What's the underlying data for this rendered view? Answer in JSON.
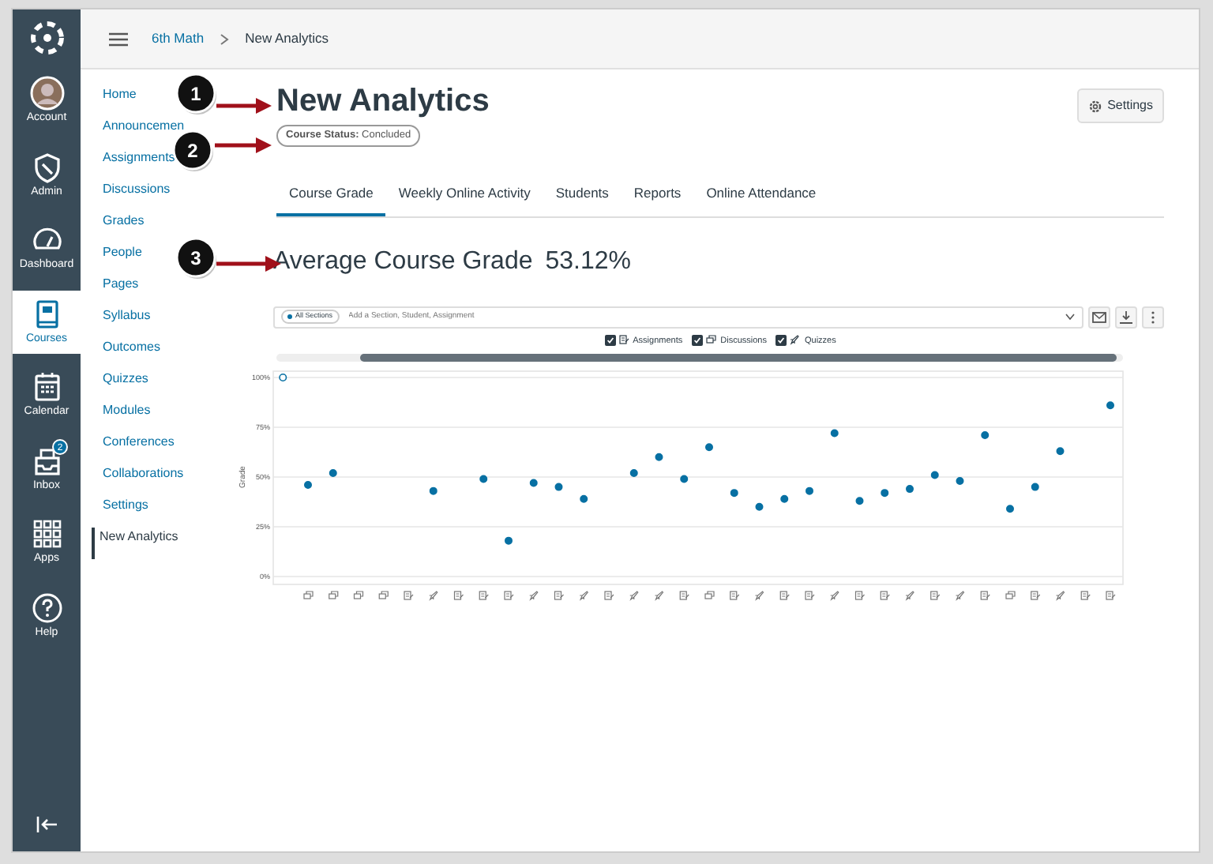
{
  "global_nav": [
    {
      "label": "Account",
      "kind": "avatar",
      "selected": false
    },
    {
      "label": "Admin",
      "kind": "shield",
      "selected": false
    },
    {
      "label": "Dashboard",
      "kind": "gauge",
      "selected": false
    },
    {
      "label": "Courses",
      "kind": "book",
      "selected": true
    },
    {
      "label": "Calendar",
      "kind": "calendar",
      "selected": false
    },
    {
      "label": "Inbox",
      "kind": "inbox",
      "selected": false,
      "badge": "2"
    },
    {
      "label": "Apps",
      "kind": "apps",
      "selected": false
    },
    {
      "label": "Help",
      "kind": "help",
      "selected": false
    }
  ],
  "breadcrumb": [
    "6th Math",
    "New Analytics"
  ],
  "course_nav": [
    {
      "label": "Home",
      "selected": false
    },
    {
      "label": "Announcemen",
      "selected": false
    },
    {
      "label": "Assignments",
      "selected": false
    },
    {
      "label": "Discussions",
      "selected": false
    },
    {
      "label": "Grades",
      "selected": false
    },
    {
      "label": "People",
      "selected": false
    },
    {
      "label": "Pages",
      "selected": false
    },
    {
      "label": "Syllabus",
      "selected": false
    },
    {
      "label": "Outcomes",
      "selected": false
    },
    {
      "label": "Quizzes",
      "selected": false
    },
    {
      "label": "Modules",
      "selected": false
    },
    {
      "label": "Conferences",
      "selected": false
    },
    {
      "label": "Collaborations",
      "selected": false
    },
    {
      "label": "Settings",
      "selected": false
    },
    {
      "label": "New Analytics",
      "selected": true
    }
  ],
  "page": {
    "title": "New Analytics",
    "status_label": "Course Status:",
    "status_value": "Concluded",
    "settings_button": "Settings"
  },
  "tabs": [
    {
      "label": "Course Grade",
      "selected": true
    },
    {
      "label": "Weekly Online Activity",
      "selected": false
    },
    {
      "label": "Students",
      "selected": false
    },
    {
      "label": "Reports",
      "selected": false
    },
    {
      "label": "Online Attendance",
      "selected": false
    }
  ],
  "summary": {
    "label": "Average Course Grade",
    "value": "53.12%"
  },
  "filter": {
    "chip": "All Sections",
    "placeholder": "Add a Section, Student, Assignment"
  },
  "legend": [
    {
      "label": "Assignments",
      "kind": "assignment",
      "checked": true
    },
    {
      "label": "Discussions",
      "kind": "discussion",
      "checked": true
    },
    {
      "label": "Quizzes",
      "kind": "quiz",
      "checked": true
    }
  ],
  "chart": {
    "x_axis_icons": [
      {
        "kind": "discussion"
      },
      {
        "kind": "discussion"
      },
      {
        "kind": "discussion"
      },
      {
        "kind": "discussion"
      },
      {
        "kind": "assignment"
      },
      {
        "kind": "quiz"
      },
      {
        "kind": "assignment"
      },
      {
        "kind": "assignment"
      },
      {
        "kind": "assignment"
      },
      {
        "kind": "quiz"
      },
      {
        "kind": "assignment"
      },
      {
        "kind": "quiz"
      },
      {
        "kind": "assignment"
      },
      {
        "kind": "quiz"
      },
      {
        "kind": "quiz"
      },
      {
        "kind": "assignment"
      },
      {
        "kind": "discussion"
      },
      {
        "kind": "assignment"
      },
      {
        "kind": "quiz"
      },
      {
        "kind": "assignment"
      },
      {
        "kind": "assignment"
      },
      {
        "kind": "quiz"
      },
      {
        "kind": "assignment"
      },
      {
        "kind": "assignment"
      },
      {
        "kind": "quiz"
      },
      {
        "kind": "assignment"
      },
      {
        "kind": "quiz"
      },
      {
        "kind": "assignment"
      },
      {
        "kind": "discussion"
      },
      {
        "kind": "assignment"
      },
      {
        "kind": "quiz"
      },
      {
        "kind": "assignment"
      },
      {
        "kind": "assignment"
      }
    ],
    "chart_data": {
      "type": "scatter",
      "grid": true,
      "ylabel": "Grade",
      "ylim": [
        0,
        100
      ],
      "yticks": [
        {
          "value": 0,
          "label": "0%"
        },
        {
          "value": 25,
          "label": "25%"
        },
        {
          "value": 50,
          "label": "50%"
        },
        {
          "value": 75,
          "label": "75%"
        },
        {
          "value": 100,
          "label": "100%"
        }
      ],
      "series": [
        {
          "color": "#ffffff",
          "values": [
            100,
            null,
            null,
            null,
            null,
            null,
            null,
            null,
            null,
            null,
            null,
            null,
            null,
            null,
            null,
            null,
            null,
            null,
            null,
            null,
            null,
            null,
            null,
            null,
            null,
            null,
            null,
            null,
            null,
            null,
            null,
            null,
            null,
            null
          ]
        },
        {
          "color": "#0770a3",
          "values": [
            null,
            46,
            52,
            null,
            null,
            null,
            43,
            null,
            49,
            18,
            47,
            45,
            39,
            null,
            52,
            60,
            49,
            65,
            42,
            35,
            39,
            43,
            72,
            38,
            42,
            44,
            51,
            48,
            71,
            34,
            45,
            63,
            null,
            86
          ]
        }
      ]
    }
  },
  "callouts": [
    {
      "number": "1"
    },
    {
      "number": "2"
    },
    {
      "number": "3"
    }
  ]
}
